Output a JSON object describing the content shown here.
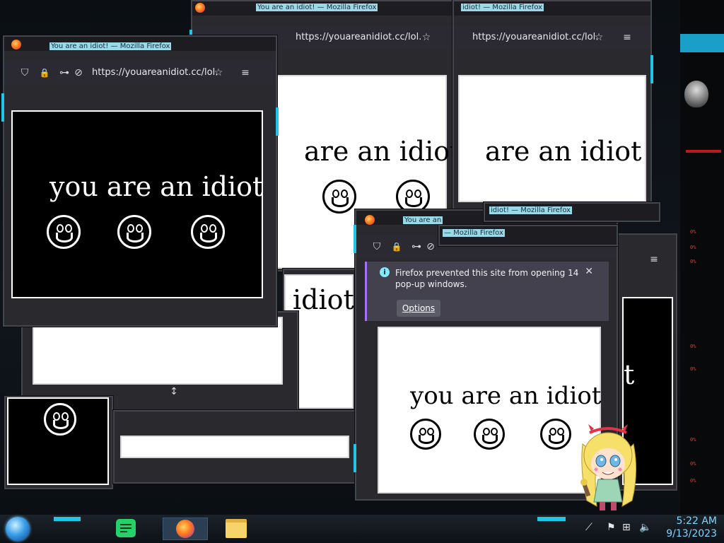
{
  "window_title": "You are an idiot! — Mozilla Firefox",
  "window_title_partial_a": "idiot! — Mozilla Firefox",
  "window_title_partial_b": "— Mozilla Firefox",
  "window_title_partial_c": "You are an",
  "window_title_partial_d": "You are an",
  "url": "https://youareanidiot.cc/lol.",
  "page_text": "you are an idiot",
  "page_text_partial_1": "are an idiot",
  "page_text_partial_2": "are an idiot",
  "page_text_partial_3": "idiot",
  "page_text_partial_4": "t",
  "notification": {
    "message": "Firefox prevented this site from opening 14 pop-up windows.",
    "info_glyph": "i",
    "options_label": "Options",
    "close_glyph": "✕"
  },
  "toolbar_icons": {
    "shield": "⛉",
    "lock": "🔒",
    "permissions": "⊶",
    "tracking": "⊘",
    "bookmark": "☆",
    "menu": "≡"
  },
  "taskbar": {
    "time": "5:22 AM",
    "date": "9/13/2023",
    "icons": [
      "start-orb",
      "notes-app",
      "firefox",
      "file-explorer"
    ]
  },
  "right_panel_labels": [
    "0%",
    "0%",
    "0%",
    "0%",
    "0%",
    "0%",
    "0%",
    "0%"
  ],
  "colors": {
    "accent_cyan": "#20c6e8",
    "notif_accent": "#a670ff",
    "firefox_toolbar": "#2b2a33"
  }
}
